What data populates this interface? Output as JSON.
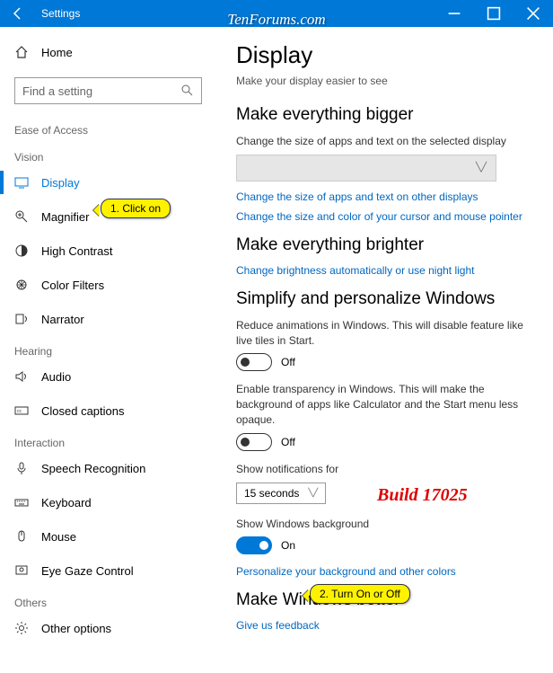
{
  "titlebar": {
    "title": "Settings"
  },
  "watermark": "TenForums.com",
  "sidebar": {
    "home": "Home",
    "search_placeholder": "Find a setting",
    "group": "Ease of Access",
    "sections": {
      "vision": "Vision",
      "hearing": "Hearing",
      "interaction": "Interaction",
      "others": "Others"
    },
    "items": {
      "display": "Display",
      "magnifier": "Magnifier",
      "high_contrast": "High Contrast",
      "color_filters": "Color Filters",
      "narrator": "Narrator",
      "audio": "Audio",
      "closed_captions": "Closed captions",
      "speech": "Speech Recognition",
      "keyboard": "Keyboard",
      "mouse": "Mouse",
      "eye_gaze": "Eye Gaze Control",
      "other": "Other options"
    }
  },
  "main": {
    "title": "Display",
    "subtitle": "Make your display easier to see",
    "sec1": {
      "heading": "Make everything bigger",
      "desc": "Change the size of apps and text on the selected display",
      "link1": "Change the size of apps and text on other displays",
      "link2": "Change the size and color of your cursor and mouse pointer"
    },
    "sec2": {
      "heading": "Make everything brighter",
      "link": "Change brightness automatically or use night light"
    },
    "sec3": {
      "heading": "Simplify and personalize Windows",
      "anim_desc": "Reduce animations in Windows.  This will disable feature like live tiles in Start.",
      "anim_state": "Off",
      "trans_desc": "Enable transparency in Windows.  This will make the background of apps like Calculator and the Start menu less opaque.",
      "trans_state": "Off",
      "notif_label": "Show notifications for",
      "notif_value": "15 seconds",
      "bg_label": "Show Windows background",
      "bg_state": "On",
      "bg_link": "Personalize your background and other colors"
    },
    "sec4": {
      "heading": "Make Windows better",
      "link": "Give us feedback"
    }
  },
  "annotations": {
    "callout1": "1. Click on",
    "callout2": "2. Turn On or Off",
    "build": "Build 17025"
  }
}
